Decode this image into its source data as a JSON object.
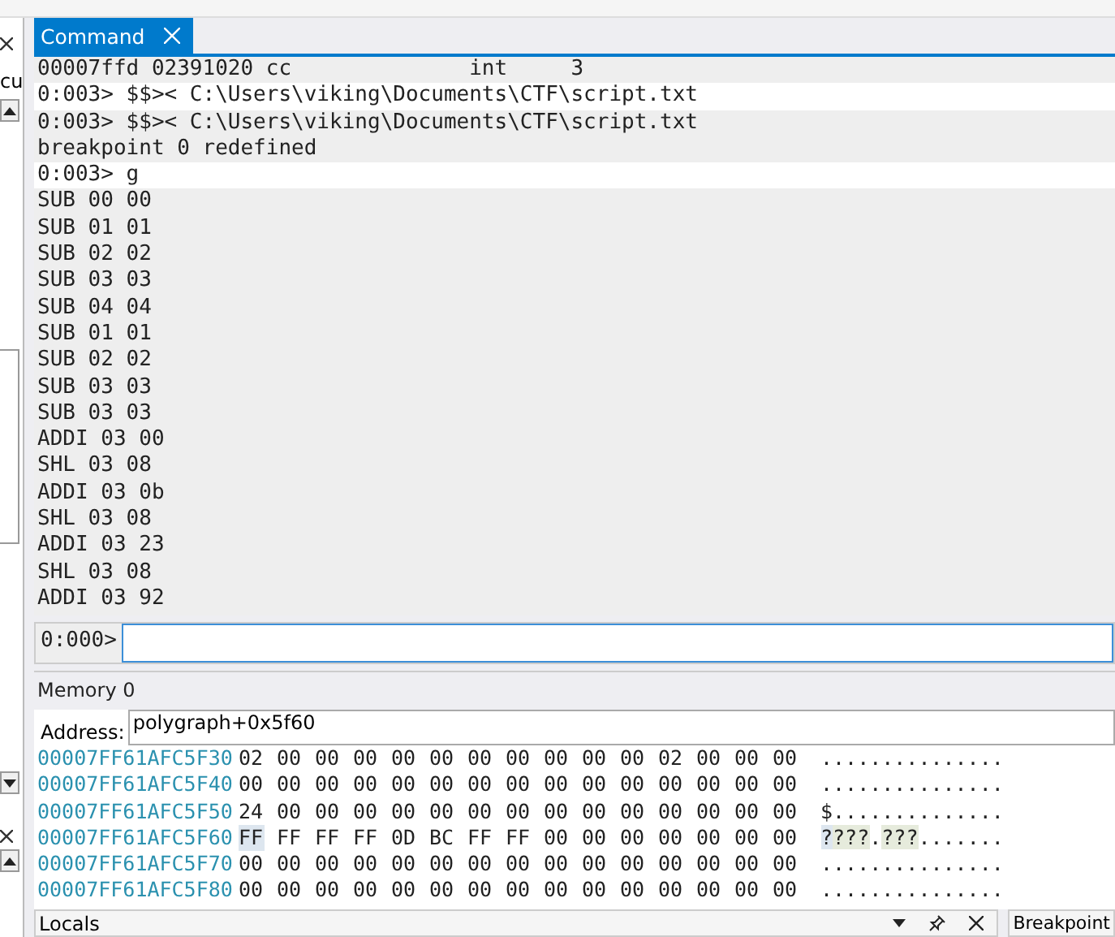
{
  "left_pane": {
    "text": "cu"
  },
  "command_window": {
    "tab": {
      "label": "Command",
      "selected": true
    },
    "lines": [
      {
        "kind": "output",
        "text": "00007ffd 02391020 cc              int     3"
      },
      {
        "kind": "command",
        "text": "0:003> $$>< C:\\Users\\viking\\Documents\\CTF\\script.txt"
      },
      {
        "kind": "output",
        "text": "0:003> $$>< C:\\Users\\viking\\Documents\\CTF\\script.txt"
      },
      {
        "kind": "output",
        "text": "breakpoint 0 redefined"
      },
      {
        "kind": "command",
        "text": "0:003> g"
      },
      {
        "kind": "output",
        "text": "SUB 00 00"
      },
      {
        "kind": "output",
        "text": "SUB 01 01"
      },
      {
        "kind": "output",
        "text": "SUB 02 02"
      },
      {
        "kind": "output",
        "text": "SUB 03 03"
      },
      {
        "kind": "output",
        "text": "SUB 04 04"
      },
      {
        "kind": "output",
        "text": "SUB 01 01"
      },
      {
        "kind": "output",
        "text": "SUB 02 02"
      },
      {
        "kind": "output",
        "text": "SUB 03 03"
      },
      {
        "kind": "output",
        "text": "SUB 03 03"
      },
      {
        "kind": "output",
        "text": "ADDI 03 00"
      },
      {
        "kind": "output",
        "text": "SHL 03 08"
      },
      {
        "kind": "output",
        "text": "ADDI 03 0b"
      },
      {
        "kind": "output",
        "text": "SHL 03 08"
      },
      {
        "kind": "output",
        "text": "ADDI 03 23"
      },
      {
        "kind": "output",
        "text": "SHL 03 08"
      },
      {
        "kind": "output",
        "text": "ADDI 03 92"
      }
    ],
    "prompt": "0:000>"
  },
  "memory_window": {
    "title": "Memory 0",
    "address_label": "Address:",
    "address_value": "polygraph+0x5f60",
    "rows": [
      {
        "address": "00007FF61AFC5F30",
        "cursor": false,
        "bytes": [
          "02",
          "00",
          "00",
          "00",
          "00",
          "00",
          "00",
          "00",
          "00",
          "00",
          "00",
          "02",
          "00",
          "00",
          "00"
        ],
        "ascii": [
          {
            "kind": "plain",
            "text": "..............."
          }
        ]
      },
      {
        "address": "00007FF61AFC5F40",
        "cursor": false,
        "bytes": [
          "00",
          "00",
          "00",
          "00",
          "00",
          "00",
          "00",
          "00",
          "00",
          "00",
          "00",
          "00",
          "00",
          "00",
          "00"
        ],
        "ascii": [
          {
            "kind": "plain",
            "text": "..............."
          }
        ]
      },
      {
        "address": "00007FF61AFC5F50",
        "cursor": false,
        "bytes": [
          "24",
          "00",
          "00",
          "00",
          "00",
          "00",
          "00",
          "00",
          "00",
          "00",
          "00",
          "00",
          "00",
          "00",
          "00"
        ],
        "ascii": [
          {
            "kind": "plain",
            "text": "$.............."
          }
        ]
      },
      {
        "address": "00007FF61AFC5F60",
        "cursor": true,
        "bytes": [
          "FF",
          "FF",
          "FF",
          "FF",
          "0D",
          "BC",
          "FF",
          "FF",
          "00",
          "00",
          "00",
          "00",
          "00",
          "00",
          "00"
        ],
        "ascii": [
          {
            "kind": "cursor",
            "text": "?"
          },
          {
            "kind": "changed",
            "text": "???"
          },
          {
            "kind": "plain",
            "text": "."
          },
          {
            "kind": "changed",
            "text": "???"
          },
          {
            "kind": "plain",
            "text": "......."
          }
        ]
      },
      {
        "address": "00007FF61AFC5F70",
        "cursor": false,
        "bytes": [
          "00",
          "00",
          "00",
          "00",
          "00",
          "00",
          "00",
          "00",
          "00",
          "00",
          "00",
          "00",
          "00",
          "00",
          "00"
        ],
        "ascii": [
          {
            "kind": "plain",
            "text": "..............."
          }
        ]
      },
      {
        "address": "00007FF61AFC5F80",
        "cursor": false,
        "bytes": [
          "00",
          "00",
          "00",
          "00",
          "00",
          "00",
          "00",
          "00",
          "00",
          "00",
          "00",
          "00",
          "00",
          "00",
          "00"
        ],
        "ascii": [
          {
            "kind": "plain",
            "text": "..............."
          }
        ]
      }
    ]
  },
  "bottom_bar": {
    "locals_title": "Locals",
    "breakpoints_title": "Breakpoint"
  }
}
